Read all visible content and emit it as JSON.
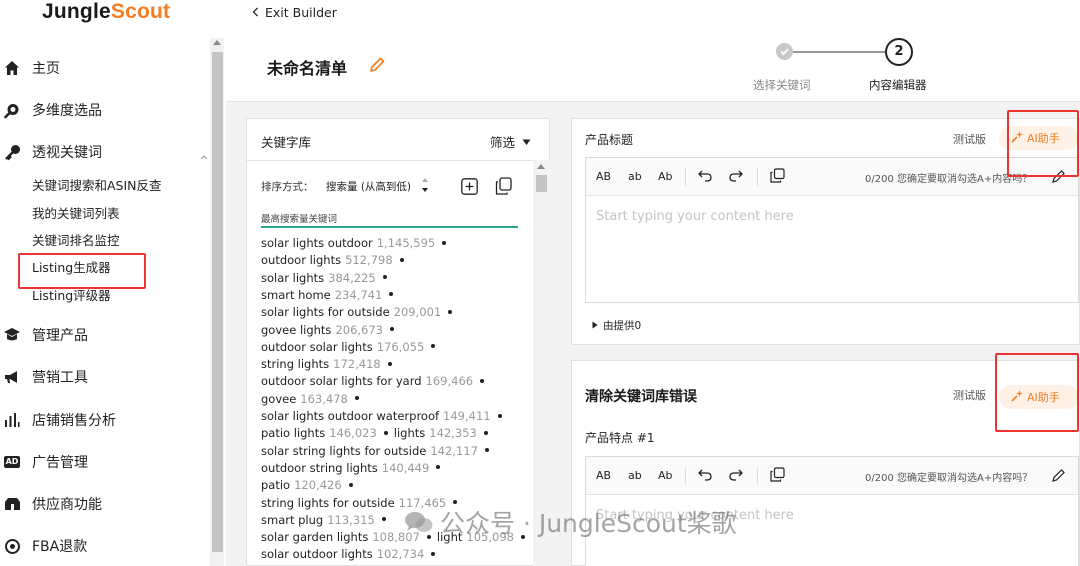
{
  "brand": {
    "part1": "Jungle",
    "part2": "Scout"
  },
  "sidebar": {
    "items": [
      {
        "label": "主页",
        "icon": "home-icon"
      },
      {
        "label": "多维度选品",
        "icon": "search-icon"
      },
      {
        "label": "透视关键词",
        "icon": "key-icon"
      },
      {
        "label": "管理产品",
        "icon": "graduation-icon"
      },
      {
        "label": "营销工具",
        "icon": "megaphone-icon"
      },
      {
        "label": "店铺销售分析",
        "icon": "bar-chart-icon"
      },
      {
        "label": "广告管理",
        "icon": "ad-icon"
      },
      {
        "label": "供应商功能",
        "icon": "supplier-icon"
      },
      {
        "label": "FBA退款",
        "icon": "refund-icon"
      }
    ],
    "subitems": [
      "关键词搜索和ASIN反查",
      "我的关键词列表",
      "关键词排名监控",
      "Listing生成器",
      "Listing评级器"
    ],
    "ad_badge": "AD"
  },
  "header": {
    "exit_label": "Exit Builder",
    "list_title": "未命名清单",
    "step1_label": "选择关键词",
    "step2_number": "2",
    "step2_label": "内容编辑器"
  },
  "keyword_panel": {
    "title": "关键字库",
    "filter_label": "筛选",
    "sort_label": "排序方式：",
    "sort_value": "搜索量 (从高到低)",
    "tab_label": "最高搜索量关键词",
    "keywords": [
      [
        {
          "text": "solar lights outdoor",
          "count": "1,145,595"
        }
      ],
      [
        {
          "text": "outdoor lights",
          "count": "512,798"
        }
      ],
      [
        {
          "text": "solar lights",
          "count": "384,225"
        }
      ],
      [
        {
          "text": "smart home",
          "count": "234,741"
        }
      ],
      [
        {
          "text": "solar lights for outside",
          "count": "209,001"
        }
      ],
      [
        {
          "text": "govee lights",
          "count": "206,673"
        }
      ],
      [
        {
          "text": "outdoor solar lights",
          "count": "176,055"
        }
      ],
      [
        {
          "text": "string lights",
          "count": "172,418"
        }
      ],
      [
        {
          "text": "outdoor solar lights for yard",
          "count": "169,466"
        }
      ],
      [
        {
          "text": "govee",
          "count": "163,478"
        }
      ],
      [
        {
          "text": "solar lights outdoor waterproof",
          "count": "149,411"
        }
      ],
      [
        {
          "text": "patio lights",
          "count": "146,023"
        },
        {
          "text": "lights",
          "count": "142,353"
        }
      ],
      [
        {
          "text": "solar string lights for outside",
          "count": "142,117"
        }
      ],
      [
        {
          "text": "outdoor string lights",
          "count": "140,449"
        }
      ],
      [
        {
          "text": "patio",
          "count": "120,426"
        }
      ],
      [
        {
          "text": "string lights for outside",
          "count": "117,465"
        }
      ],
      [
        {
          "text": "smart plug",
          "count": "113,315"
        }
      ],
      [
        {
          "text": "solar garden lights",
          "count": "108,807"
        },
        {
          "text": "light",
          "count": "105,098"
        }
      ],
      [
        {
          "text": "solar outdoor lights",
          "count": "102,734"
        }
      ]
    ]
  },
  "title_section": {
    "label": "产品标题",
    "beta_label": "测试版",
    "ai_label": "AI助手",
    "toolbar": {
      "ab_upper": "AB",
      "ab_lower": "ab",
      "ab_title": "Ab"
    },
    "counter": "0/200 您确定要取消勾选A+内容吗？",
    "placeholder": "Start typing your content here",
    "provided_by": "由提供0"
  },
  "errors_section": {
    "title": "清除关键词库错误",
    "beta_label": "测试版",
    "ai_label": "AI助手",
    "feature_label": "产品特点 #1",
    "toolbar": {
      "ab_upper": "AB",
      "ab_lower": "ab",
      "ab_title": "Ab"
    },
    "counter": "0/200 您确定要取消勾选A+内容吗？",
    "placeholder": "Start typing your content here"
  },
  "watermark": {
    "text": "公众号 · JungleScout桨歌"
  },
  "colors": {
    "accent": "#f57c1f",
    "highlight_box": "#e33333",
    "step_done": "#c8c8c8",
    "tab_underline": "#2ba58c"
  }
}
